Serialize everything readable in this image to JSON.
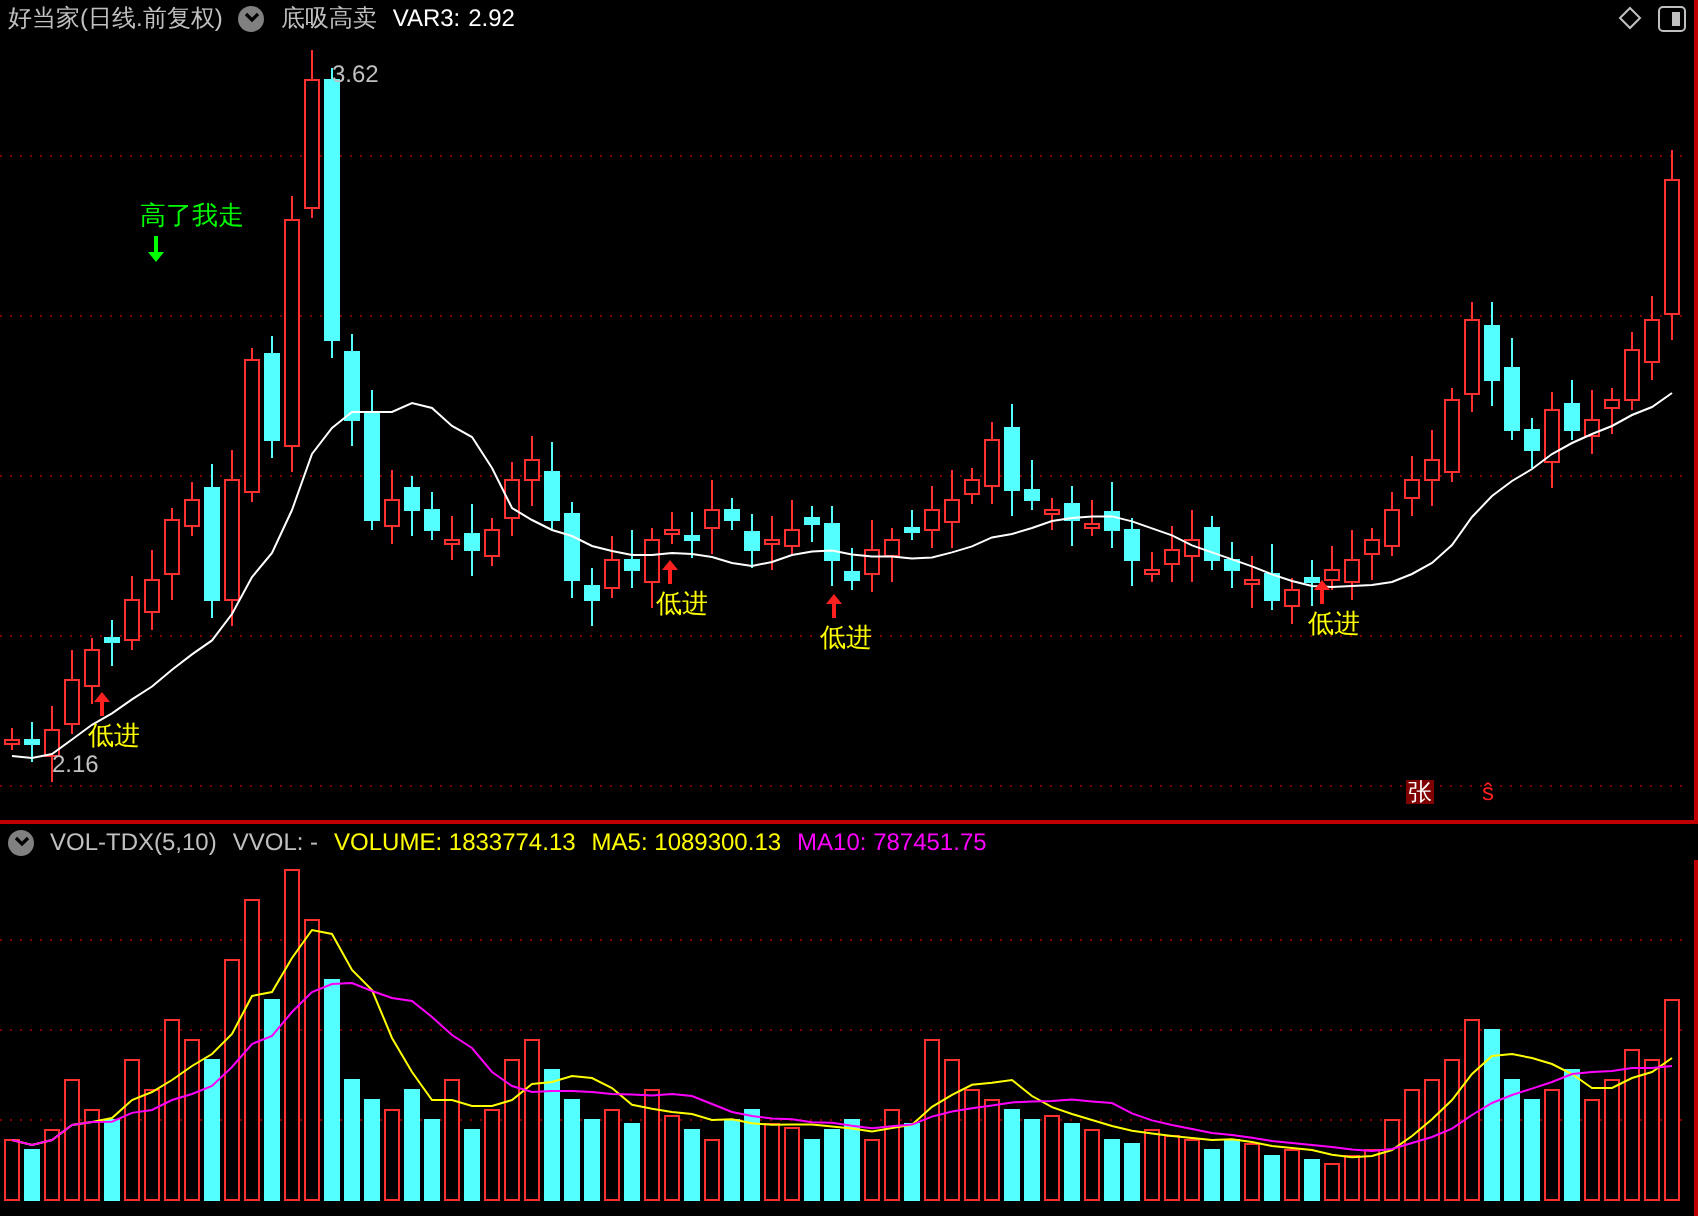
{
  "title_bar": {
    "title": "好当家(日线.前复权)",
    "indicator": "底吸高卖",
    "var_label": "VAR3:",
    "var_value": "2.92"
  },
  "price_chart": {
    "high_label": "3.62",
    "low_label": "2.16",
    "signals": [
      {
        "kind": "sell",
        "label": "高了我走"
      },
      {
        "kind": "buy",
        "label": "低进"
      },
      {
        "kind": "buy",
        "label": "低进"
      },
      {
        "kind": "buy",
        "label": "低进"
      },
      {
        "kind": "buy",
        "label": "低进"
      }
    ]
  },
  "markers": [
    {
      "kind": "boxed",
      "label": "张"
    },
    {
      "kind": "plain",
      "label": "ŝ"
    }
  ],
  "volume_panel": {
    "name": "VOL-TDX(5,10)",
    "readings": [
      {
        "label": "VVOL: -",
        "color": "#c0c0c0"
      },
      {
        "label": "VOLUME: 1833774.13",
        "color": "#ffff00"
      },
      {
        "label": "MA5: 1089300.13",
        "color": "#ffff00"
      },
      {
        "label": "MA10: 787451.75",
        "color": "#ff00ff"
      }
    ]
  }
}
